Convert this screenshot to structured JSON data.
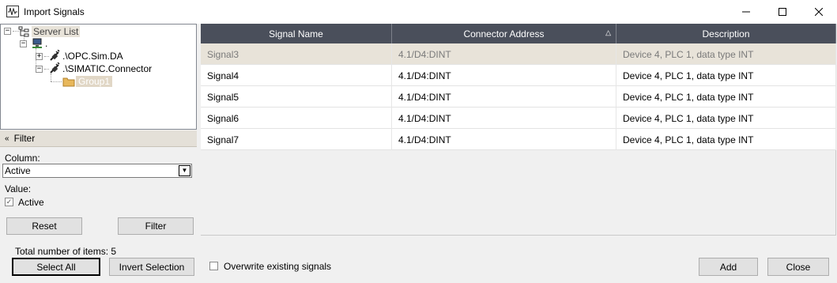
{
  "window": {
    "title": "Import Signals",
    "minimize_glyph": "—",
    "maximize_glyph": "☐",
    "close_glyph": "✕"
  },
  "tree": {
    "root_label": "Server List",
    "computer_label": ".",
    "children": [
      {
        "label": ".\\OPC.Sim.DA",
        "expander": "+"
      },
      {
        "label": ".\\SIMATIC.Connector",
        "expander": "−"
      }
    ],
    "group_label": "Group1",
    "root_expander": "−",
    "computer_expander": "−"
  },
  "filter": {
    "header": "Filter",
    "collapse_glyph": "«",
    "column_label": "Column:",
    "column_value": "Active",
    "value_label": "Value:",
    "active_label": "Active",
    "active_checked": true,
    "reset_label": "Reset",
    "filter_label": "Filter"
  },
  "grid": {
    "columns": [
      "Signal Name",
      "Connector Address",
      "Description"
    ],
    "sort_glyph": "△",
    "rows": [
      {
        "name": "Signal3",
        "address": "4.1/D4:DINT",
        "description": "Device 4, PLC 1, data type INT",
        "selected": true
      },
      {
        "name": "Signal4",
        "address": "4.1/D4:DINT",
        "description": "Device 4, PLC 1, data type INT",
        "selected": false
      },
      {
        "name": "Signal5",
        "address": "4.1/D4:DINT",
        "description": "Device 4, PLC 1, data type INT",
        "selected": false
      },
      {
        "name": "Signal6",
        "address": "4.1/D4:DINT",
        "description": "Device 4, PLC 1, data type INT",
        "selected": false
      },
      {
        "name": "Signal7",
        "address": "4.1/D4:DINT",
        "description": "Device 4, PLC 1, data type INT",
        "selected": false
      }
    ]
  },
  "footer": {
    "total_items": "Total number of items: 5",
    "select_all_label": "Select All",
    "invert_selection_label": "Invert Selection",
    "overwrite_label": "Overwrite existing signals",
    "overwrite_checked": false,
    "add_label": "Add",
    "close_label": "Close"
  },
  "checkmark_glyph": "✓",
  "dropdown_glyph": "▼"
}
